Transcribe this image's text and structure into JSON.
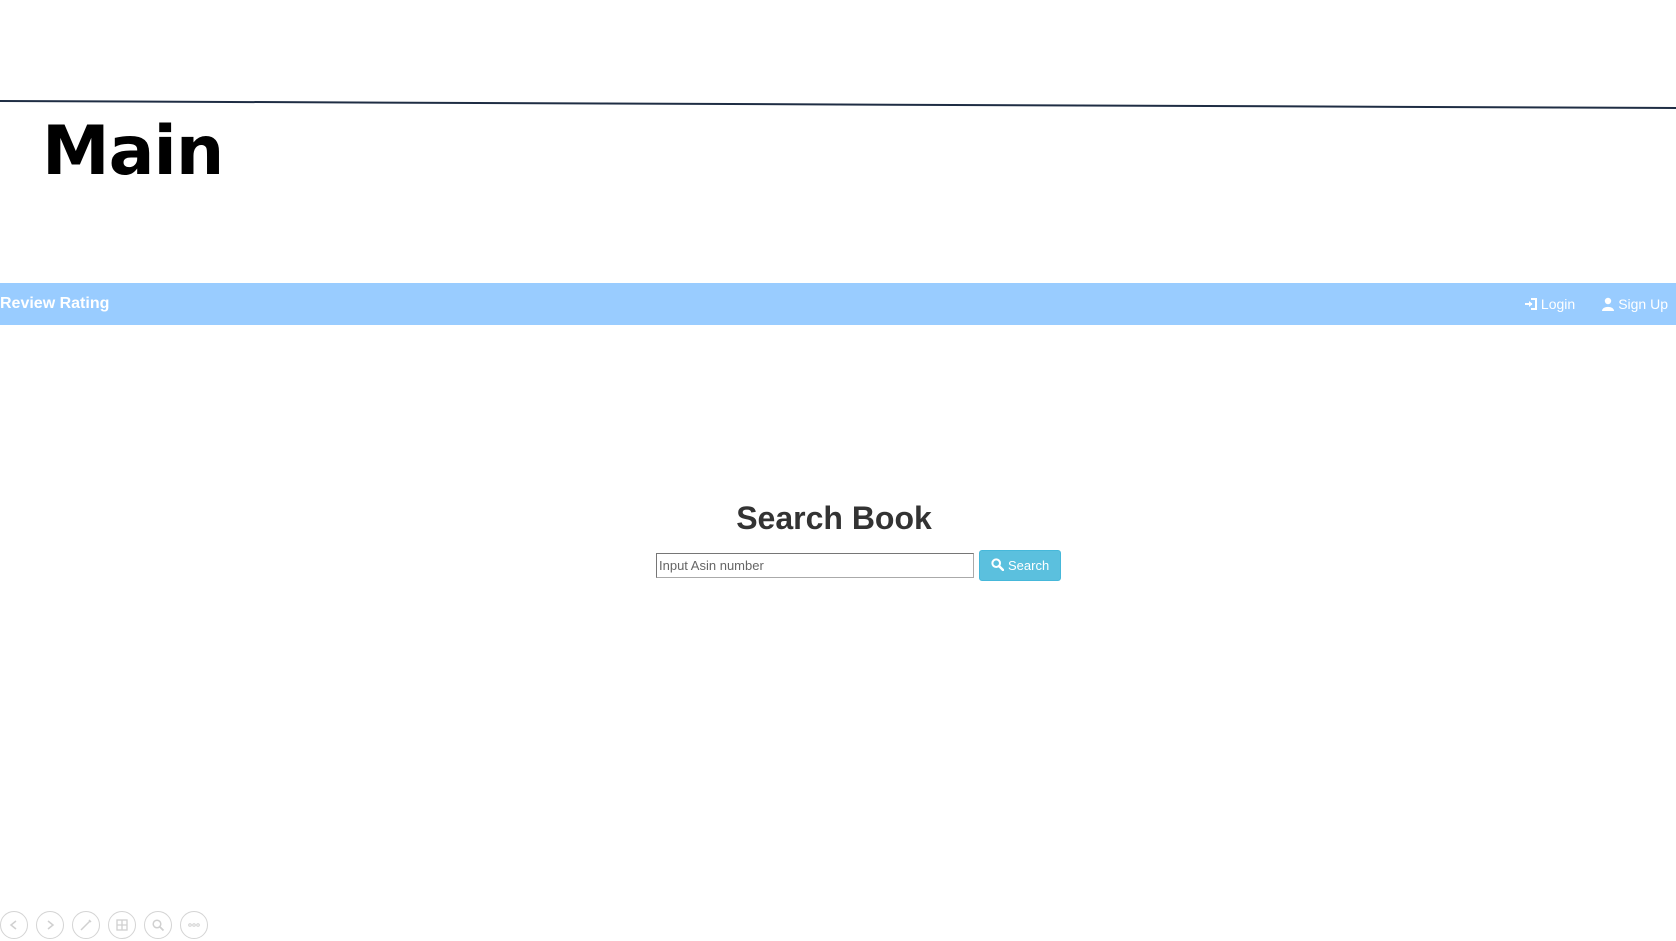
{
  "slide": {
    "title": "Main",
    "rule_color": "#1f2d44"
  },
  "navbar": {
    "brand": "Review Rating",
    "background": "#99ccff",
    "login_label": "Login",
    "signup_label": "Sign Up"
  },
  "search": {
    "heading": "Search Book",
    "placeholder": "Input Asin number",
    "value": "",
    "button_label": "Search",
    "button_color": "#5bc0de"
  },
  "viewer_toolbar": {
    "icons": [
      "previous-icon",
      "next-icon",
      "pen-icon",
      "slides-grid-icon",
      "zoom-icon",
      "more-icon"
    ]
  }
}
